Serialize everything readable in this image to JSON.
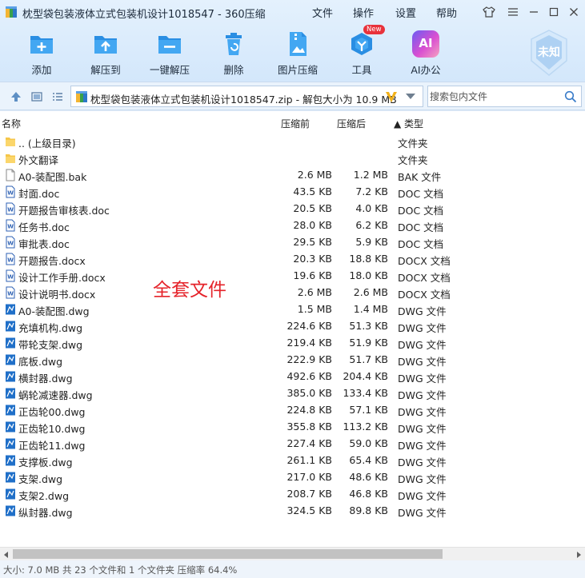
{
  "window": {
    "title": "枕型袋包装液体立式包装机设计1018547 - 360压缩",
    "menus": [
      "文件",
      "操作",
      "设置",
      "帮助"
    ]
  },
  "toolbar": {
    "buttons": [
      {
        "label": "添加",
        "icon": "add-icon"
      },
      {
        "label": "解压到",
        "icon": "extract-to-icon"
      },
      {
        "label": "一键解压",
        "icon": "one-click-extract-icon"
      },
      {
        "label": "删除",
        "icon": "delete-icon"
      },
      {
        "label": "图片压缩",
        "icon": "image-compress-icon"
      },
      {
        "label": "工具",
        "icon": "tools-icon",
        "badge": "New"
      },
      {
        "label": "AI办公",
        "icon": "ai-office-icon",
        "glyph": "AI"
      }
    ],
    "shield_badge": "未知"
  },
  "address": {
    "path": "枕型袋包装液体立式包装机设计1018547.zip - 解包大小为 10.9 MB",
    "search_placeholder": "搜索包内文件"
  },
  "columns": {
    "name": "名称",
    "compressed_before": "压缩前",
    "compressed_after": "压缩后",
    "type": "▲ 类型"
  },
  "files": [
    {
      "name": ".. (上级目录)",
      "before": "",
      "after": "",
      "type": "文件夹",
      "icon": "folder"
    },
    {
      "name": "外文翻译",
      "before": "",
      "after": "",
      "type": "文件夹",
      "icon": "folder"
    },
    {
      "name": "A0-装配图.bak",
      "before": "2.6 MB",
      "after": "1.2 MB",
      "type": "BAK 文件",
      "icon": "file"
    },
    {
      "name": "封面.doc",
      "before": "43.5 KB",
      "after": "7.2 KB",
      "type": "DOC 文档",
      "icon": "word"
    },
    {
      "name": "开题报告审核表.doc",
      "before": "20.5 KB",
      "after": "4.0 KB",
      "type": "DOC 文档",
      "icon": "word"
    },
    {
      "name": "任务书.doc",
      "before": "28.0 KB",
      "after": "6.2 KB",
      "type": "DOC 文档",
      "icon": "word"
    },
    {
      "name": "审批表.doc",
      "before": "29.5 KB",
      "after": "5.9 KB",
      "type": "DOC 文档",
      "icon": "word"
    },
    {
      "name": "开题报告.docx",
      "before": "20.3 KB",
      "after": "18.8 KB",
      "type": "DOCX 文档",
      "icon": "word"
    },
    {
      "name": "设计工作手册.docx",
      "before": "19.6 KB",
      "after": "18.0 KB",
      "type": "DOCX 文档",
      "icon": "word"
    },
    {
      "name": "设计说明书.docx",
      "before": "2.6 MB",
      "after": "2.6 MB",
      "type": "DOCX 文档",
      "icon": "word"
    },
    {
      "name": "A0-装配图.dwg",
      "before": "1.5 MB",
      "after": "1.4 MB",
      "type": "DWG 文件",
      "icon": "dwg"
    },
    {
      "name": "充填机构.dwg",
      "before": "224.6 KB",
      "after": "51.3 KB",
      "type": "DWG 文件",
      "icon": "dwg"
    },
    {
      "name": "带轮支架.dwg",
      "before": "219.4 KB",
      "after": "51.9 KB",
      "type": "DWG 文件",
      "icon": "dwg"
    },
    {
      "name": "底板.dwg",
      "before": "222.9 KB",
      "after": "51.7 KB",
      "type": "DWG 文件",
      "icon": "dwg"
    },
    {
      "name": "横封器.dwg",
      "before": "492.6 KB",
      "after": "204.4 KB",
      "type": "DWG 文件",
      "icon": "dwg"
    },
    {
      "name": "蜗轮减速器.dwg",
      "before": "385.0 KB",
      "after": "133.4 KB",
      "type": "DWG 文件",
      "icon": "dwg"
    },
    {
      "name": "正齿轮00.dwg",
      "before": "224.8 KB",
      "after": "57.1 KB",
      "type": "DWG 文件",
      "icon": "dwg"
    },
    {
      "name": "正齿轮10.dwg",
      "before": "355.8 KB",
      "after": "113.2 KB",
      "type": "DWG 文件",
      "icon": "dwg"
    },
    {
      "name": "正齿轮11.dwg",
      "before": "227.4 KB",
      "after": "59.0 KB",
      "type": "DWG 文件",
      "icon": "dwg"
    },
    {
      "name": "支撑板.dwg",
      "before": "261.1 KB",
      "after": "65.4 KB",
      "type": "DWG 文件",
      "icon": "dwg"
    },
    {
      "name": "支架.dwg",
      "before": "217.0 KB",
      "after": "48.6 KB",
      "type": "DWG 文件",
      "icon": "dwg"
    },
    {
      "name": "支架2.dwg",
      "before": "208.7 KB",
      "after": "46.8 KB",
      "type": "DWG 文件",
      "icon": "dwg"
    },
    {
      "name": "纵封器.dwg",
      "before": "324.5 KB",
      "after": "89.8 KB",
      "type": "DWG 文件",
      "icon": "dwg"
    }
  ],
  "overlay_text": "全套文件",
  "status": "大小: 7.0 MB 共 23 个文件和 1 个文件夹 压缩率 64.4%",
  "colors": {
    "accent": "#2b8fe0",
    "overlay": "#e5232a",
    "dwg": "#1f6fc8",
    "folder": "#f6c649"
  }
}
